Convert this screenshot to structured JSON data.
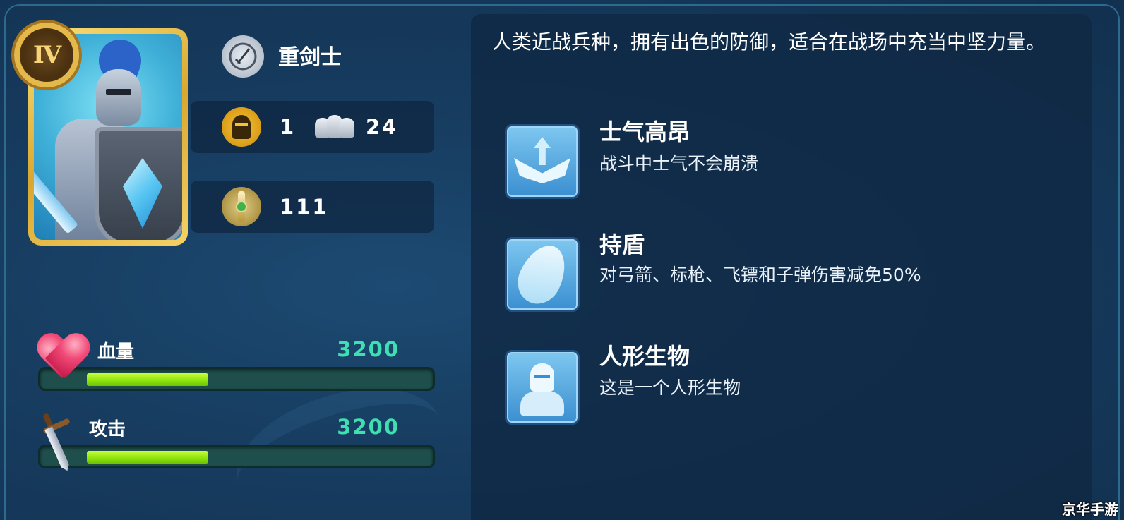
{
  "unit": {
    "rank": "IV",
    "class_name": "重剑士",
    "cost": "1",
    "troop_count": "24",
    "power": "111",
    "description": "人类近战兵种，拥有出色的防御，适合在战场中充当中坚力量。"
  },
  "stats": {
    "hp": {
      "label": "血量",
      "value": "3200",
      "fill_fraction": 0.36
    },
    "attack": {
      "label": "攻击",
      "value": "3200",
      "fill_fraction": 0.36
    }
  },
  "skills": [
    {
      "name": "士气高昂",
      "description": "战斗中士气不会崩溃",
      "icon": "wing-arrow-up-icon"
    },
    {
      "name": "持盾",
      "description": "对弓箭、标枪、飞镖和子弹伤害减免50%",
      "icon": "shield-deflect-icon"
    },
    {
      "name": "人形生物",
      "description": "这是一个人形生物",
      "icon": "humanoid-icon"
    }
  ],
  "watermark": "京华手游",
  "colors": {
    "background": "#173d61",
    "bar_fill": "#8de20c",
    "stat_value": "#3ee0b2",
    "card_gold": "#e5b84a",
    "skill_icon": "#3a8fd0"
  }
}
